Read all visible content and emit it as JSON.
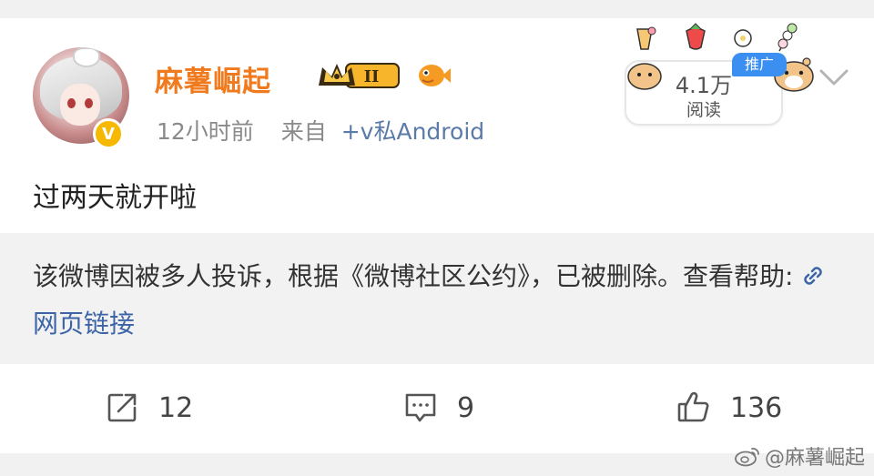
{
  "user": {
    "name": "麻薯崛起",
    "level_badge": "II",
    "verified_glyph": "V"
  },
  "meta": {
    "time": "12小时前",
    "from_label": "来自",
    "source": "+v私Android"
  },
  "stats": {
    "read_count": "4.1万",
    "read_label": "阅读",
    "promo_label": "推广"
  },
  "post": {
    "text": "过两天就开啦"
  },
  "notice": {
    "text": "该微博因被多人投诉，根据《微博社区公约》，已被删除。查看帮助:",
    "link_label": "网页链接"
  },
  "actions": {
    "repost_count": "12",
    "comment_count": "9",
    "like_count": "136"
  },
  "watermark": {
    "text": "@麻薯崛起"
  },
  "icons": {
    "link": "link-icon",
    "repost": "repost-icon",
    "comment": "comment-icon",
    "like": "thumbs-up-icon",
    "more": "chevron-down-icon"
  },
  "colors": {
    "username": "#f07a1d",
    "link": "#3c64a6",
    "promo": "#3a8ff0",
    "verified": "#f6b800"
  }
}
